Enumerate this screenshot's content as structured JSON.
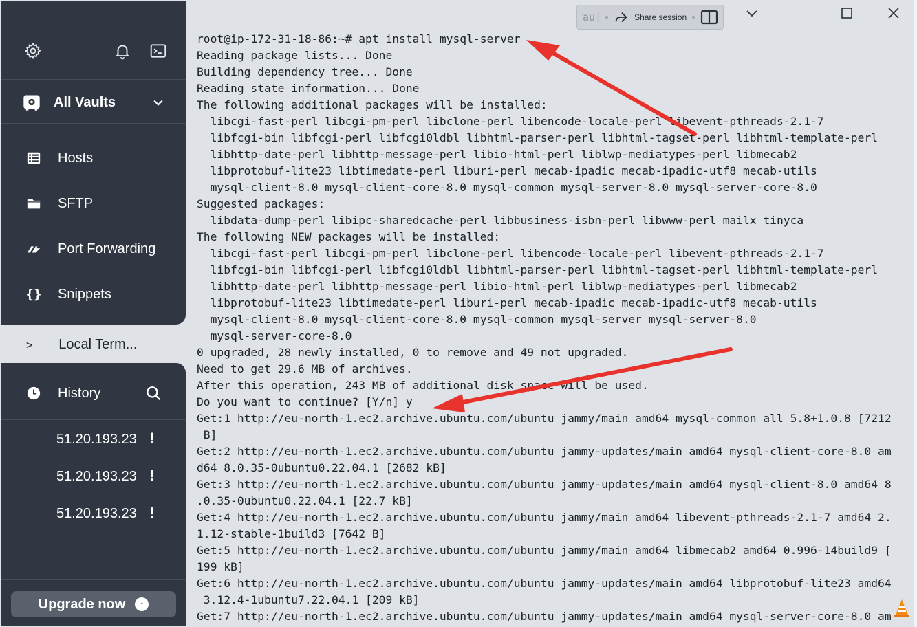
{
  "sidebar": {
    "vault_label": "All Vaults",
    "nav": [
      {
        "label": "Hosts",
        "icon": "hosts-icon"
      },
      {
        "label": "SFTP",
        "icon": "folder-icon"
      },
      {
        "label": "Port Forwarding",
        "icon": "port-forwarding-icon"
      },
      {
        "label": "Snippets",
        "icon": "snippets-icon"
      }
    ],
    "local_terminal": {
      "label": "Local Term...",
      "icon": ">_"
    },
    "history": {
      "label": "History"
    },
    "hosts": [
      {
        "address": "51.20.193.23",
        "badge": "!"
      },
      {
        "address": "51.20.193.23",
        "badge": "!"
      },
      {
        "address": "51.20.193.23",
        "badge": "!"
      }
    ],
    "upgrade_label": "Upgrade now",
    "upgrade_arrow": "↑"
  },
  "titlebar": {
    "autocomplete": "au|",
    "share_label": "Share session"
  },
  "terminal": {
    "lines": [
      "root@ip-172-31-18-86:~# apt install mysql-server",
      "Reading package lists... Done",
      "Building dependency tree... Done",
      "Reading state information... Done",
      "The following additional packages will be installed:",
      "  libcgi-fast-perl libcgi-pm-perl libclone-perl libencode-locale-perl libevent-pthreads-2.1-7",
      "  libfcgi-bin libfcgi-perl libfcgi0ldbl libhtml-parser-perl libhtml-tagset-perl libhtml-template-perl",
      "  libhttp-date-perl libhttp-message-perl libio-html-perl liblwp-mediatypes-perl libmecab2",
      "  libprotobuf-lite23 libtimedate-perl liburi-perl mecab-ipadic mecab-ipadic-utf8 mecab-utils",
      "  mysql-client-8.0 mysql-client-core-8.0 mysql-common mysql-server-8.0 mysql-server-core-8.0",
      "Suggested packages:",
      "  libdata-dump-perl libipc-sharedcache-perl libbusiness-isbn-perl libwww-perl mailx tinyca",
      "The following NEW packages will be installed:",
      "  libcgi-fast-perl libcgi-pm-perl libclone-perl libencode-locale-perl libevent-pthreads-2.1-7",
      "  libfcgi-bin libfcgi-perl libfcgi0ldbl libhtml-parser-perl libhtml-tagset-perl libhtml-template-perl",
      "  libhttp-date-perl libhttp-message-perl libio-html-perl liblwp-mediatypes-perl libmecab2",
      "  libprotobuf-lite23 libtimedate-perl liburi-perl mecab-ipadic mecab-ipadic-utf8 mecab-utils",
      "  mysql-client-8.0 mysql-client-core-8.0 mysql-common mysql-server mysql-server-8.0",
      "  mysql-server-core-8.0",
      "0 upgraded, 28 newly installed, 0 to remove and 49 not upgraded.",
      "Need to get 29.6 MB of archives.",
      "After this operation, 243 MB of additional disk space will be used.",
      "Do you want to continue? [Y/n] y",
      "Get:1 http://eu-north-1.ec2.archive.ubuntu.com/ubuntu jammy/main amd64 mysql-common all 5.8+1.0.8 [7212",
      " B]",
      "Get:2 http://eu-north-1.ec2.archive.ubuntu.com/ubuntu jammy-updates/main amd64 mysql-client-core-8.0 am",
      "d64 8.0.35-0ubuntu0.22.04.1 [2682 kB]",
      "Get:3 http://eu-north-1.ec2.archive.ubuntu.com/ubuntu jammy-updates/main amd64 mysql-client-8.0 amd64 8",
      ".0.35-0ubuntu0.22.04.1 [22.7 kB]",
      "Get:4 http://eu-north-1.ec2.archive.ubuntu.com/ubuntu jammy/main amd64 libevent-pthreads-2.1-7 amd64 2.",
      "1.12-stable-1build3 [7642 B]",
      "Get:5 http://eu-north-1.ec2.archive.ubuntu.com/ubuntu jammy/main amd64 libmecab2 amd64 0.996-14build9 [",
      "199 kB]",
      "Get:6 http://eu-north-1.ec2.archive.ubuntu.com/ubuntu jammy-updates/main amd64 libprotobuf-lite23 amd64",
      " 3.12.4-1ubuntu7.22.04.1 [209 kB]",
      "Get:7 http://eu-north-1.ec2.archive.ubuntu.com/ubuntu jammy-updates/main amd64 mysql-server-core-8.0 am"
    ]
  },
  "colors": {
    "sidebar_bg": "#313742",
    "terminal_bg": "#dfe3e8",
    "terminal_text": "#1d2128",
    "annotation_arrow": "#e8322c",
    "upgrade_bg": "#5b616c"
  }
}
